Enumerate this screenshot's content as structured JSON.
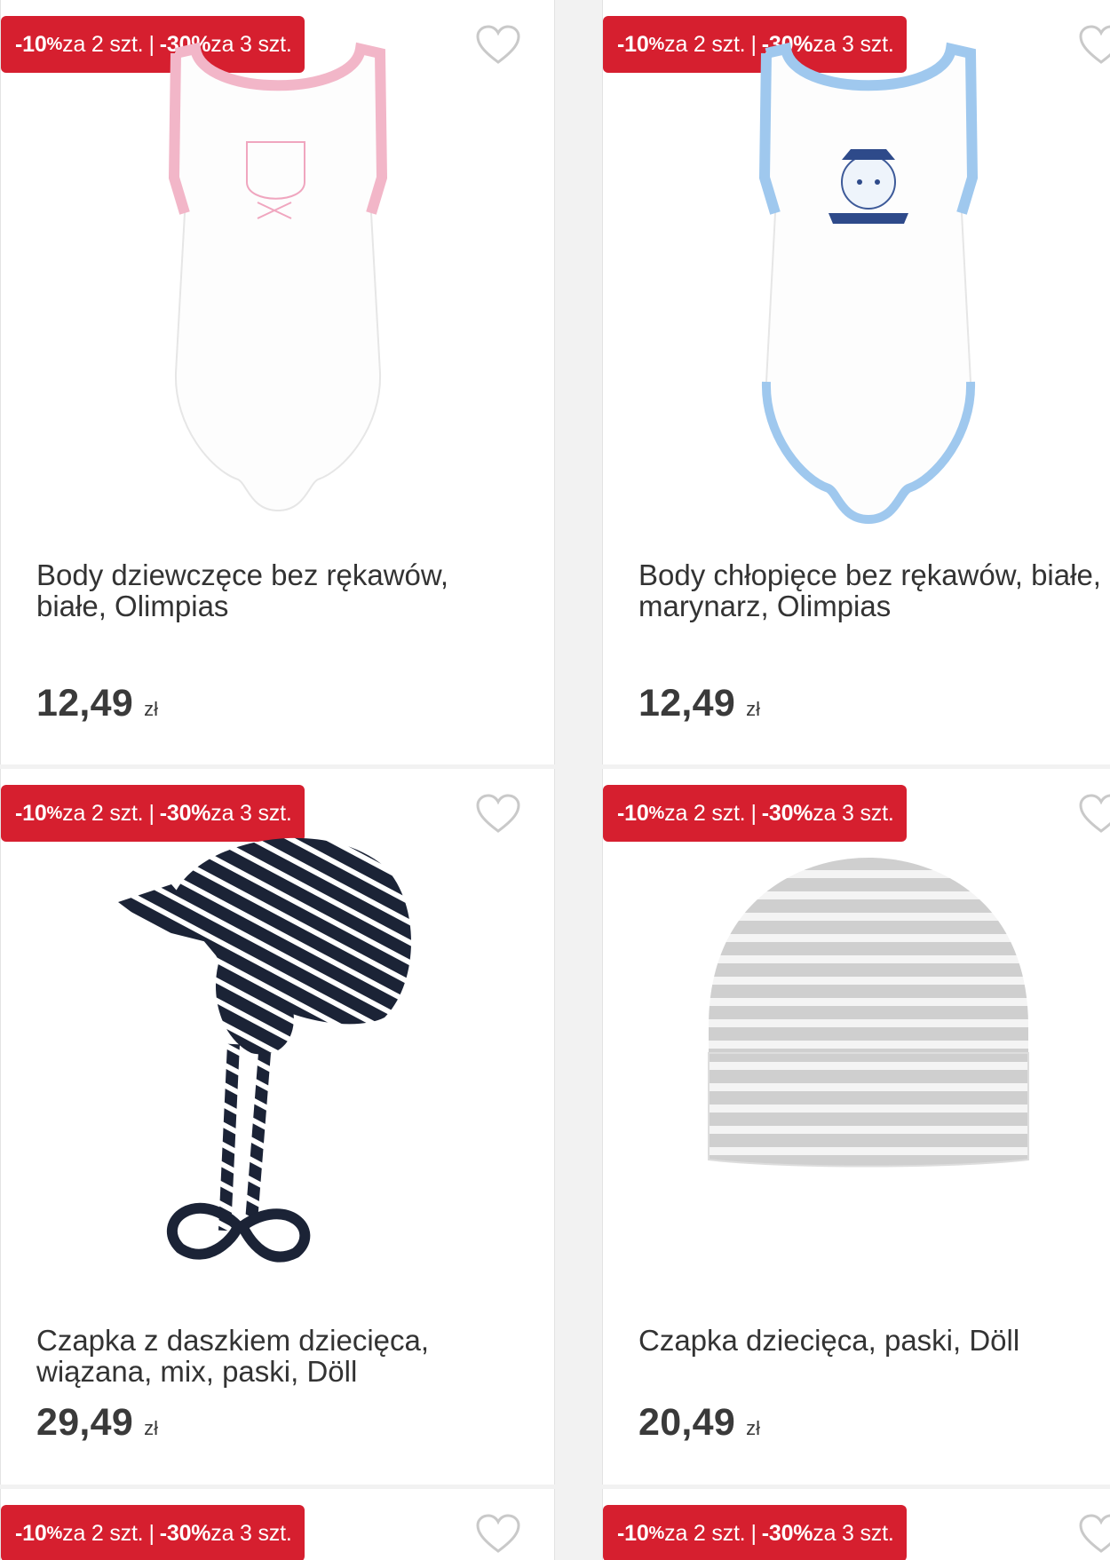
{
  "promo": {
    "part1_value": "-10",
    "part1_pct": "%",
    "part1_rest": " za 2 szt.",
    "separator": "|",
    "part2_value": "-30%",
    "part2_rest": " za 3 szt."
  },
  "products": [
    {
      "title": "Body dziewczęce bez rękawów,\nbiałe, Olimpias",
      "price": "12,49",
      "currency": "zł",
      "accent_color": "#f2b6c8",
      "image": "girl-bodysuit-image"
    },
    {
      "title": "Body chłopięce bez rękawów, białe,\nmarynarz, Olimpias",
      "price": "12,49",
      "currency": "zł",
      "accent_color": "#9fc8ee",
      "image": "boy-sailor-bodysuit-image"
    },
    {
      "title": "Czapka z daszkiem dziecięca,\nwiązana, mix, paski, Döll",
      "price": "29,49",
      "currency": "zł",
      "accent_color": "#1b2336",
      "image": "striped-cap-image"
    },
    {
      "title": "Czapka dziecięca, paski, Döll",
      "price": "20,49",
      "currency": "zł",
      "accent_color": "#cfcfcf",
      "image": "striped-beanie-image"
    }
  ],
  "colors": {
    "badge": "#d61f2f",
    "text": "#333333",
    "heart": "#c9c9c9"
  }
}
